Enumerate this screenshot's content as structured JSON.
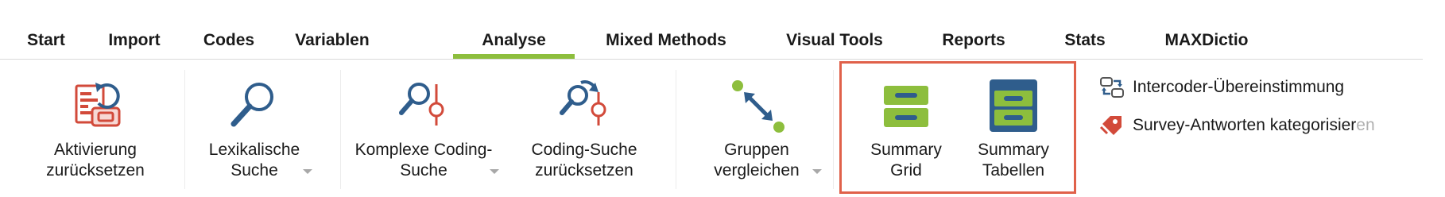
{
  "tabs": [
    {
      "label": "Start"
    },
    {
      "label": "Import"
    },
    {
      "label": "Codes"
    },
    {
      "label": "Variablen"
    },
    {
      "label": "Analyse",
      "active": true
    },
    {
      "label": "Mixed Methods"
    },
    {
      "label": "Visual Tools"
    },
    {
      "label": "Reports"
    },
    {
      "label": "Stats"
    },
    {
      "label": "MAXDictio"
    }
  ],
  "ribbon": {
    "aktivierung": {
      "line1": "Aktivierung",
      "line2": "zurücksetzen",
      "icon": "reset-activation-icon"
    },
    "lexikalisch": {
      "line1": "Lexikalische",
      "line2": "Suche",
      "icon": "magnifier-icon",
      "has_dropdown": true
    },
    "komplex": {
      "line1": "Komplexe Coding-",
      "line2": "Suche",
      "icon": "complex-coding-search-icon",
      "has_dropdown": true
    },
    "coding_reset": {
      "line1": "Coding-Suche",
      "line2": "zurücksetzen",
      "icon": "reset-coding-search-icon"
    },
    "gruppen": {
      "line1": "Gruppen",
      "line2": "vergleichen",
      "icon": "compare-groups-icon",
      "has_dropdown": true
    },
    "summary_grid": {
      "line1": "Summary",
      "line2": "Grid",
      "icon": "summary-grid-icon"
    },
    "summary_tabellen": {
      "line1": "Summary",
      "line2": "Tabellen",
      "icon": "summary-tables-icon"
    },
    "intercoder": {
      "label": "Intercoder-Übereinstimmung",
      "icon": "intercoder-icon"
    },
    "survey": {
      "label_main": "Survey-Antworten kategorisier",
      "label_tail": "en",
      "icon": "survey-tag-icon"
    }
  },
  "colors": {
    "accent": "#8dbe3d",
    "highlight_border": "#e0614a",
    "icon_blue": "#2f5d8c",
    "icon_red": "#d24a3a",
    "icon_green": "#8dbe3d"
  }
}
